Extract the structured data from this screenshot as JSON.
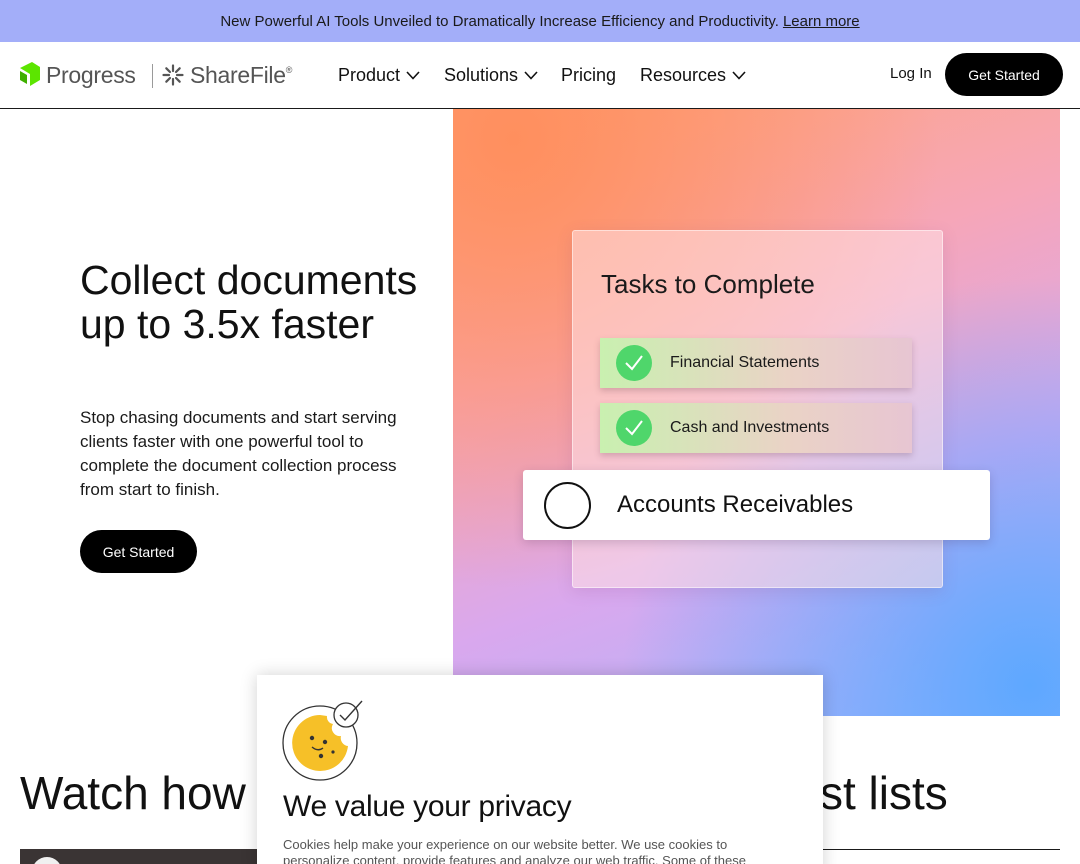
{
  "announcement": {
    "text": "New Powerful AI Tools Unveiled to Dramatically Increase Efficiency and Productivity.",
    "link": "Learn more"
  },
  "nav": {
    "logo_progress": "Progress",
    "logo_sharefile": "ShareFile",
    "logo_trademark": "®",
    "items": [
      "Product",
      "Solutions",
      "Pricing",
      "Resources"
    ],
    "login": "Log In",
    "cta": "Get Started"
  },
  "hero": {
    "title": "Collect documents up to 3.5x faster",
    "subtitle": "Stop chasing documents and start serving clients faster with one powerful tool to complete the document collection process from start to finish.",
    "cta": "Get Started"
  },
  "task_card": {
    "title": "Tasks to Complete",
    "completed": [
      "Financial Statements",
      "Cash and Investments"
    ],
    "pending": "Accounts Receivables"
  },
  "section": {
    "heading_left": "Watch how",
    "heading_right": "st lists"
  },
  "cookie": {
    "title": "We value your privacy",
    "text": "Cookies help make your experience on our website better. We use cookies to personalize content, provide features and analyze our web traffic. Some of these"
  },
  "colors": {
    "announcement_bg": "#a3aef9",
    "progress_green": "#5ce500",
    "check_green": "#4fd66b",
    "cta_bg": "#000000"
  }
}
